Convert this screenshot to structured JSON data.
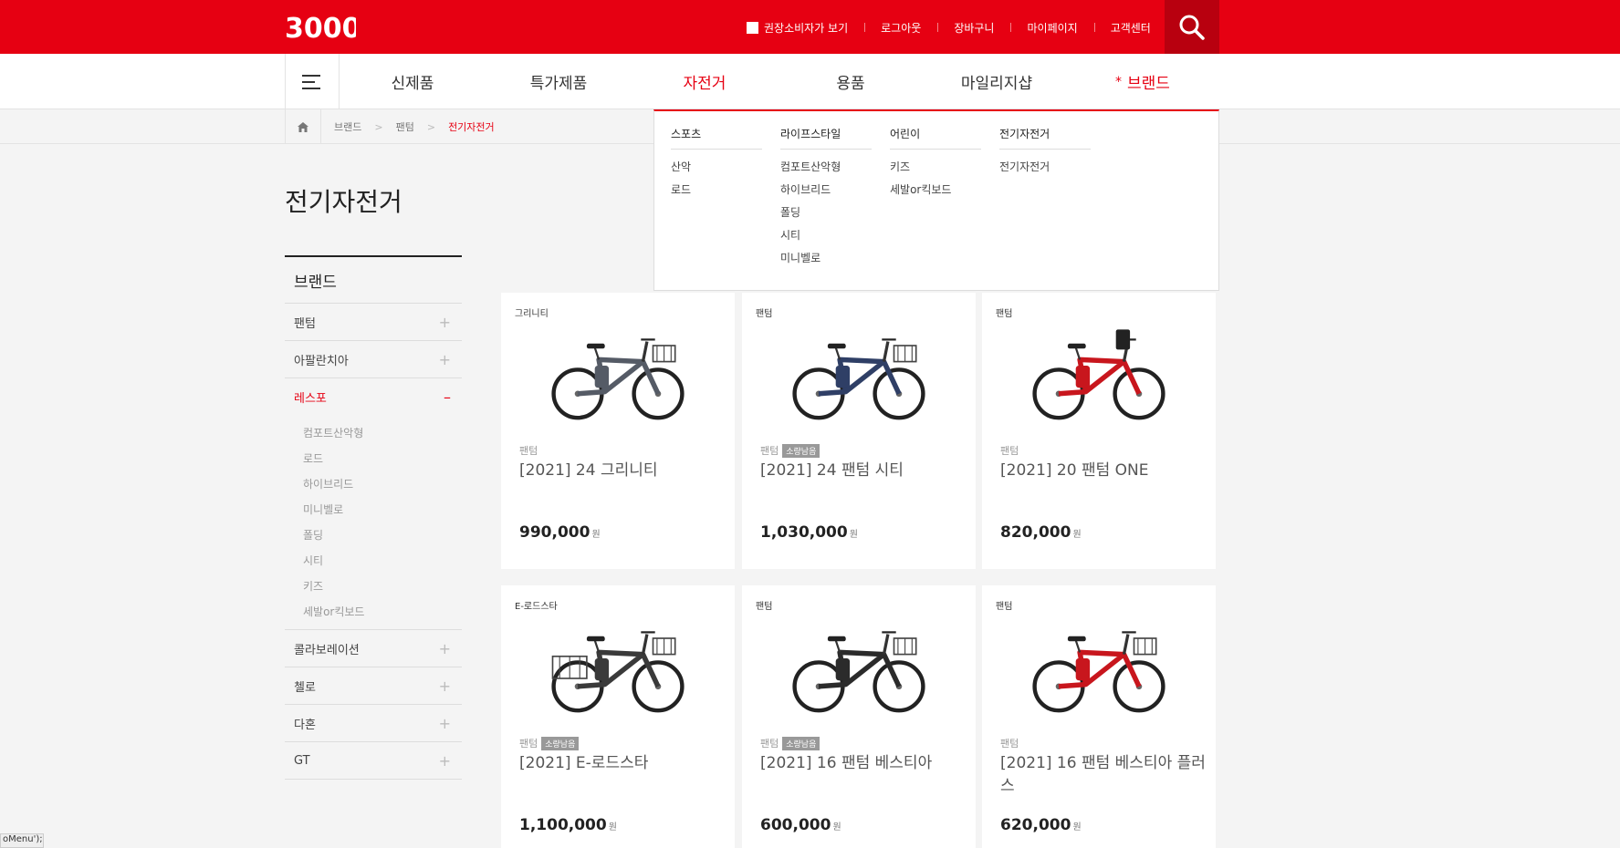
{
  "header": {
    "logo_text": "3000",
    "top_links": [
      {
        "label": "권장소비자가 보기",
        "checkbox": true
      },
      {
        "label": "로그아웃"
      },
      {
        "label": "장바구니"
      },
      {
        "label": "마이페이지"
      },
      {
        "label": "고객센터"
      }
    ],
    "search_icon": "search-icon"
  },
  "nav": {
    "menu_icon": "hamburger-icon",
    "items": [
      {
        "label": "신제품"
      },
      {
        "label": "특가제품"
      },
      {
        "label": "자전거",
        "active": true
      },
      {
        "label": "용품"
      },
      {
        "label": "마일리지샵"
      },
      {
        "label": "브랜드",
        "star": "*"
      }
    ]
  },
  "breadcrumb": {
    "home_icon": "home-icon",
    "items": [
      "브랜드",
      "팬텀",
      "전기자전거"
    ]
  },
  "page": {
    "title": "전기자전거"
  },
  "sidebar": {
    "heading": "브랜드",
    "items": [
      {
        "label": "팬텀"
      },
      {
        "label": "아팔란치아"
      },
      {
        "label": "레스포",
        "open": true,
        "sub": [
          "컴포트산악형",
          "로드",
          "하이브리드",
          "미니벨로",
          "폴딩",
          "시티",
          "키즈",
          "세발or킥보드"
        ]
      },
      {
        "label": "콜라보레이션"
      },
      {
        "label": "첼로"
      },
      {
        "label": "다혼"
      },
      {
        "label": "GT"
      }
    ]
  },
  "dropdown": {
    "columns": [
      {
        "head": "스포츠",
        "items": [
          "산악",
          "로드"
        ]
      },
      {
        "head": "라이프스타일",
        "items": [
          "컴포트산악형",
          "하이브리드",
          "폴딩",
          "시티",
          "미니벨로"
        ]
      },
      {
        "head": "어린이",
        "items": [
          "키즈",
          "세발or킥보드"
        ]
      },
      {
        "head": "전기자전거",
        "items": [
          "전기자전거"
        ]
      }
    ]
  },
  "products": [
    {
      "tag": "그리니티",
      "brand": "팬텀",
      "badge": "",
      "name": "[2021] 24 그리니티",
      "price": "990,000",
      "unit": "원",
      "color": "#555b66",
      "basket": "front"
    },
    {
      "tag": "팬텀",
      "brand": "팬텀",
      "badge": "소량남음",
      "name": "[2021] 24 팬텀 시티",
      "price": "1,030,000",
      "unit": "원",
      "color": "#2f3f66",
      "basket": "front"
    },
    {
      "tag": "팬텀",
      "brand": "팬텀",
      "badge": "",
      "name": "[2021] 20 팬텀 ONE",
      "price": "820,000",
      "unit": "원",
      "color": "#c8161d",
      "basket": "none"
    },
    {
      "tag": "E-로드스타",
      "brand": "팬텀",
      "badge": "소량남음",
      "name": "[2021] E-로드스타",
      "price": "1,100,000",
      "unit": "원",
      "color": "#3a3a3a",
      "basket": "both"
    },
    {
      "tag": "팬텀",
      "brand": "팬텀",
      "badge": "소량남음",
      "name": "[2021] 16 팬텀 베스티아",
      "price": "600,000",
      "unit": "원",
      "color": "#2b2b2b",
      "basket": "front"
    },
    {
      "tag": "팬텀",
      "brand": "팬텀",
      "badge": "",
      "name": "[2021] 16 팬텀 베스티아 플러스",
      "price": "620,000",
      "unit": "원",
      "color": "#c8161d",
      "basket": "front"
    }
  ],
  "debug": {
    "label": "oMenu');"
  }
}
